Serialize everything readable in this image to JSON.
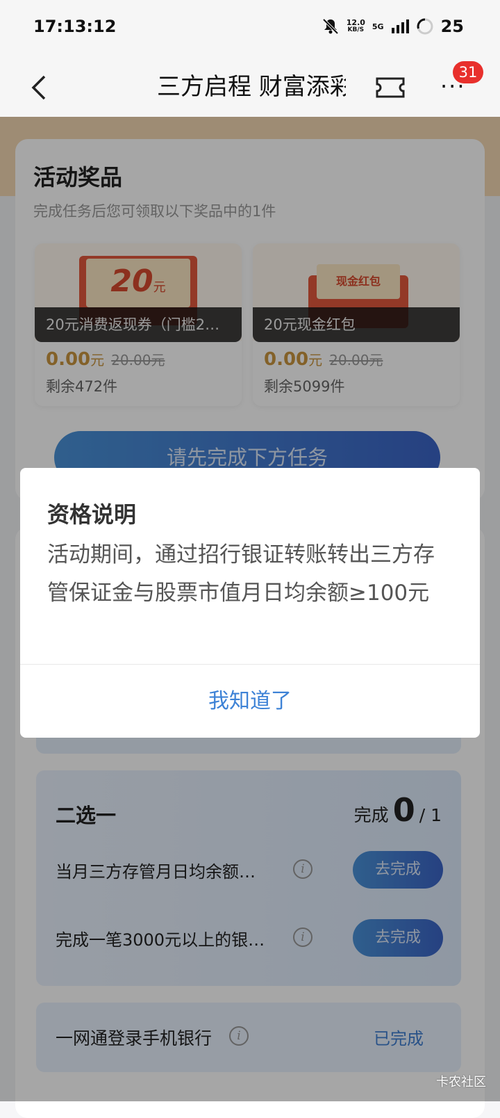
{
  "status_bar": {
    "time": "17:13:12",
    "net_speed_value": "12.0",
    "net_speed_unit": "KB/S",
    "network": "5G",
    "battery": "25",
    "icons": [
      "mute-bell-icon",
      "signal-icon",
      "battery-ring-icon"
    ]
  },
  "nav": {
    "title": "三方启程 财富添彩",
    "badge": "31",
    "icons": [
      "back-chevron-icon",
      "ticket-icon",
      "more-dots-icon"
    ]
  },
  "prizes": {
    "title": "活动奖品",
    "subtitle": "完成任务后您可领取以下奖品中的1件",
    "items": [
      {
        "image_text": "20",
        "image_unit": "元",
        "label": "20元消费返现券（门槛2…",
        "price": "0.00",
        "price_unit": "元",
        "original": "20.00元",
        "remaining": "剩余472件"
      },
      {
        "image_text": "现金红包",
        "label": "20元现金红包",
        "price": "0.00",
        "price_unit": "元",
        "original": "20.00元",
        "remaining": "剩余5099件"
      }
    ],
    "cta": "请先完成下方任务"
  },
  "tasks": {
    "choose_title": "二选一",
    "progress_label": "完成",
    "progress_done": "0",
    "progress_sep": "/",
    "progress_total": "1",
    "rows": [
      {
        "text": "当月三方存管月日均余额…",
        "button": "去完成"
      },
      {
        "text": "完成一笔3000元以上的银…",
        "button": "去完成"
      }
    ],
    "completed_row": {
      "text": "一网通登录手机银行",
      "status": "已完成"
    }
  },
  "dialog": {
    "title": "资格说明",
    "body": "活动期间，通过招行银证转账转出三方存管保证金与股票市值月日均余额≥100元",
    "button": "我知道了"
  },
  "watermark": "卡农社区",
  "colors": {
    "accent_blue": "#3d82d6",
    "badge_red": "#e8302c",
    "price_gold": "#c9963f"
  }
}
